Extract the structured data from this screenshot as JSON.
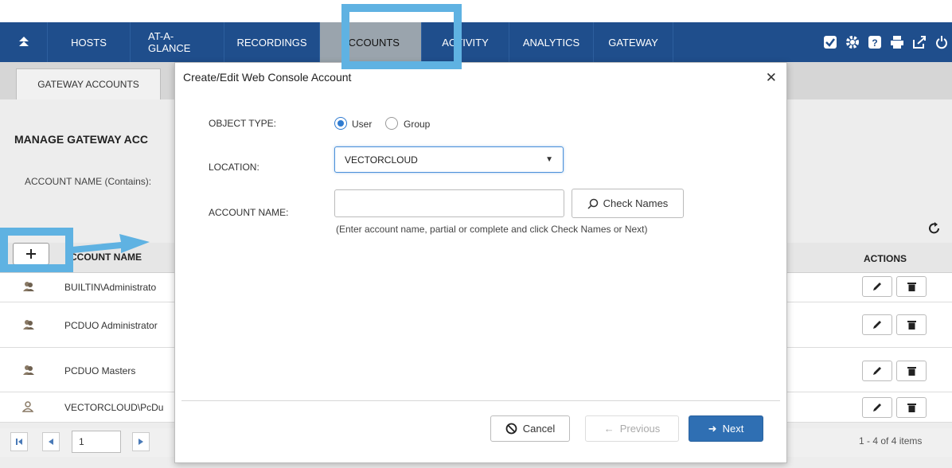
{
  "nav": {
    "home_icon": "up-arrows-icon",
    "tabs": [
      {
        "label": "HOSTS"
      },
      {
        "label": "AT-A-GLANCE"
      },
      {
        "label": "RECORDINGS"
      },
      {
        "label": "ACCOUNTS",
        "active": true
      },
      {
        "label": "ACTIVITY"
      },
      {
        "label": "ANALYTICS"
      },
      {
        "label": "GATEWAY"
      }
    ],
    "tools": [
      "check-icon",
      "gear-icon",
      "help-icon",
      "print-icon",
      "export-icon",
      "power-icon"
    ]
  },
  "subtab": {
    "label": "GATEWAY ACCOUNTS"
  },
  "page": {
    "title": "MANAGE GATEWAY ACC",
    "account_name_filter_label": "ACCOUNT NAME (Contains):",
    "column_account": "CCOUNT NAME",
    "column_actions": "ACTIONS",
    "rows": [
      {
        "name": "BUILTIN\\Administrato",
        "icon": "group-icon"
      },
      {
        "name": "PCDUO Administrator",
        "icon": "group-icon"
      },
      {
        "name": "PCDUO Masters",
        "icon": "group-icon"
      },
      {
        "name": "VECTORCLOUD\\PcDu",
        "icon": "user-icon"
      }
    ],
    "pager": {
      "page": "1",
      "info": "1 - 4 of 4 items"
    }
  },
  "modal": {
    "title": "Create/Edit Web Console Account",
    "object_type_label": "OBJECT TYPE:",
    "option_user": "User",
    "option_group": "Group",
    "selected_type": "User",
    "location_label": "LOCATION:",
    "location_value": "VECTORCLOUD",
    "account_name_label": "ACCOUNT NAME:",
    "account_name_value": "",
    "check_names_label": "Check Names",
    "hint": "(Enter account name, partial or complete and click Check Names or Next)",
    "cancel_label": "Cancel",
    "previous_label": "Previous",
    "next_label": "Next"
  },
  "colors": {
    "nav_bg": "#1f4e8c",
    "highlight": "#5fb2e2",
    "primary_button": "#2f6fb3"
  }
}
